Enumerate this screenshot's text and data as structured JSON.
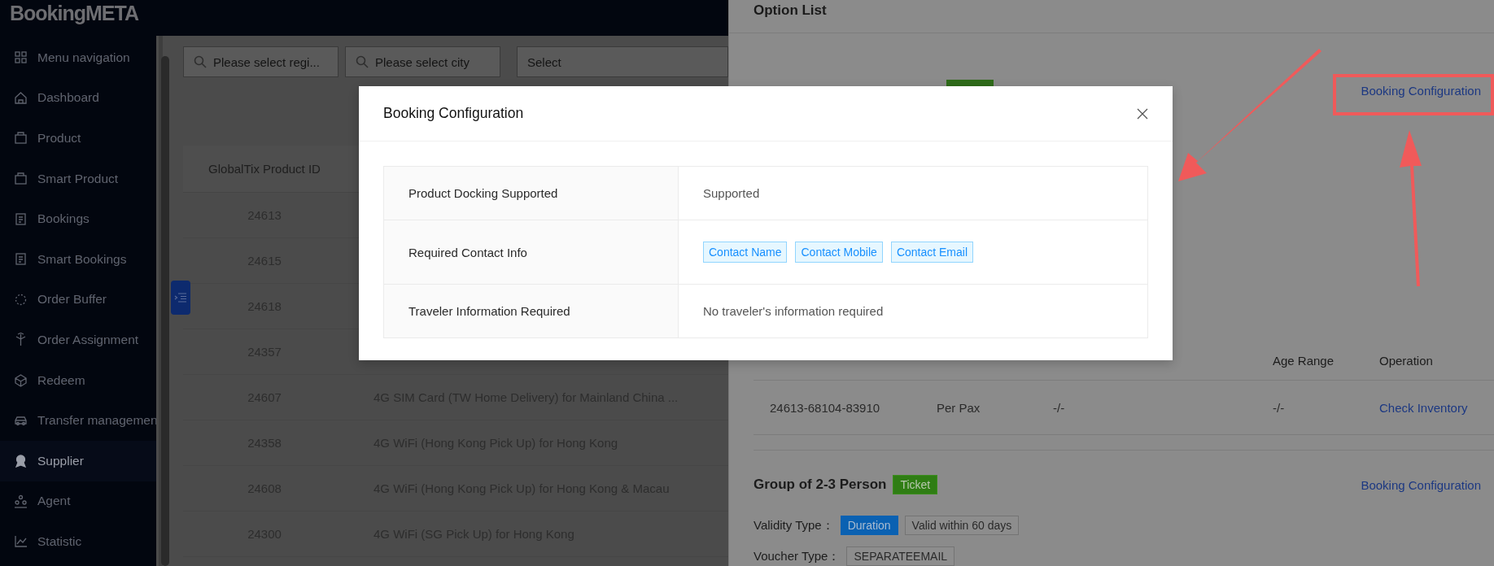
{
  "sidebar": {
    "logo": "BookingMETA",
    "items": [
      {
        "label": "Menu navigation",
        "selected": false
      },
      {
        "label": "Dashboard",
        "selected": false
      },
      {
        "label": "Product",
        "selected": false
      },
      {
        "label": "Smart Product",
        "selected": false
      },
      {
        "label": "Bookings",
        "selected": false
      },
      {
        "label": "Smart Bookings",
        "selected": false
      },
      {
        "label": "Order Buffer",
        "selected": false
      },
      {
        "label": "Order Assignment",
        "selected": false
      },
      {
        "label": "Redeem",
        "selected": false
      },
      {
        "label": "Transfer managemen",
        "selected": false
      },
      {
        "label": "Supplier",
        "selected": true
      },
      {
        "label": "Agent",
        "selected": false
      },
      {
        "label": "Statistic",
        "selected": false
      }
    ]
  },
  "filters": [
    {
      "kind": "search",
      "placeholder": "Please select regi..."
    },
    {
      "kind": "search",
      "placeholder": "Please select city"
    },
    {
      "kind": "select",
      "placeholder": "Select"
    }
  ],
  "product_table": {
    "columns": [
      "GlobalTix Product ID"
    ],
    "rows": [
      {
        "id": "24613"
      },
      {
        "id": "24615"
      },
      {
        "id": "24618"
      },
      {
        "id": "24357"
      },
      {
        "id": "24607",
        "name": "4G SIM Card (TW Home Delivery) for Mainland China ..."
      },
      {
        "id": "24358",
        "name": "4G WiFi (Hong Kong Pick Up) for Hong Kong"
      },
      {
        "id": "24608",
        "name": "4G WiFi (Hong Kong Pick Up) for Hong Kong & Macau"
      },
      {
        "id": "24300",
        "name": "4G WiFi (SG Pick Up) for Hong Kong"
      }
    ]
  },
  "option_list": {
    "title": "Option List",
    "first_option_link": "Booking Configuration",
    "table": {
      "columns": [
        "Age Range",
        "Operation"
      ],
      "rows": [
        {
          "mapping_id": "24613-68104-83910",
          "ticket_name": "Per Pax",
          "quantity": "-/-",
          "age_range": "-/-",
          "operation": "Check Inventory"
        }
      ]
    },
    "second_option": {
      "title": "Group of 2-3 Person",
      "tag": "Ticket",
      "link": "Booking Configuration",
      "fields": [
        {
          "label": "Validity Type：",
          "tags": [
            {
              "text": "Duration",
              "kind": "primary"
            },
            {
              "text": "Valid within 60 days",
              "kind": "plain"
            }
          ]
        },
        {
          "label": "Voucher Type：",
          "tags": [
            {
              "text": "SEPARATEEMAIL",
              "kind": "plain"
            }
          ]
        }
      ]
    }
  },
  "modal": {
    "title": "Booking Configuration",
    "rows": [
      {
        "kind": "text",
        "label": "Product Docking Supported",
        "value": "Supported"
      },
      {
        "kind": "tags",
        "label": "Required Contact Info",
        "tags": [
          "Contact Name",
          "Contact Mobile",
          "Contact Email"
        ]
      },
      {
        "kind": "text",
        "label": "Traveler Information Required",
        "value": "No traveler's information required"
      }
    ]
  }
}
